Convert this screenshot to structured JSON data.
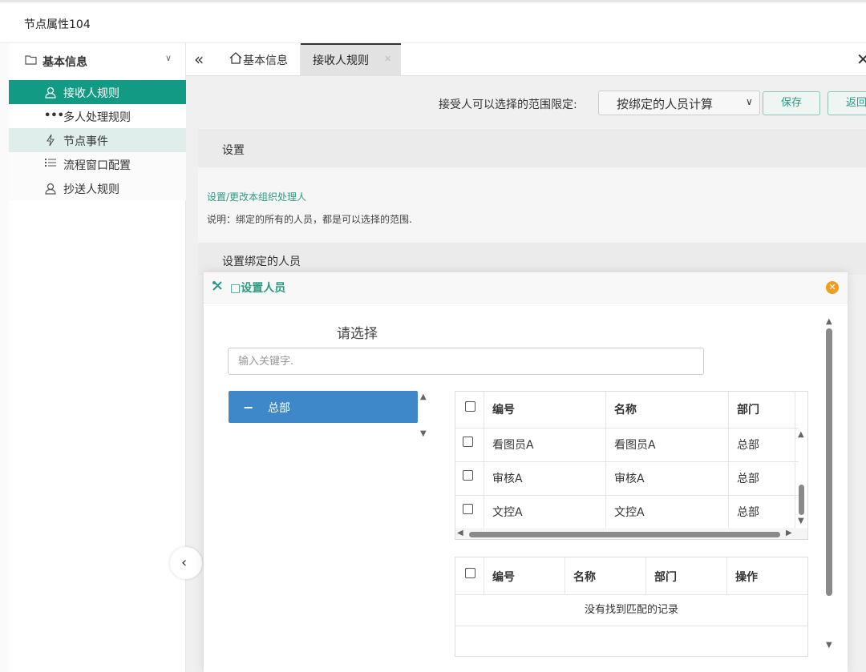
{
  "window": {
    "title": "节点属性104"
  },
  "sidebar": {
    "section": {
      "label": "基本信息",
      "icon": "folder-icon",
      "chevron": "∨"
    },
    "items": [
      {
        "label": "接收人规则",
        "icon": "user-icon",
        "state": "active"
      },
      {
        "label": "多人处理规则",
        "icon": "ellipsis-icon",
        "state": "normal"
      },
      {
        "label": "节点事件",
        "icon": "bolt-icon",
        "state": "hover"
      },
      {
        "label": "流程窗口配置",
        "icon": "list-icon",
        "state": "normal"
      },
      {
        "label": "抄送人规则",
        "icon": "user-icon",
        "state": "normal"
      }
    ]
  },
  "tabs": [
    {
      "label": "基本信息",
      "icon": "home-icon"
    },
    {
      "label": "接收人规则",
      "active": true
    }
  ],
  "toolbar": {
    "range_label": "接受人可以选择的范围限定:",
    "range_value": "按绑定的人员计算",
    "save_label": "保存",
    "back_label": "返回"
  },
  "settings": {
    "title": "设置",
    "link": "设置/更改本组织处理人",
    "note": "说明：绑定的所有的人员，都是可以选择的范围."
  },
  "bound": {
    "title": "设置绑定的人员"
  },
  "modal": {
    "title": "□设置人员",
    "pick_title": "请选择",
    "keyword_placeholder": "输入关键字.",
    "tree_node": "总部",
    "candidates": {
      "headers": [
        "编号",
        "名称",
        "部门"
      ],
      "rows": [
        [
          "看图员A",
          "看图员A",
          "总部"
        ],
        [
          "审核A",
          "审核A",
          "总部"
        ],
        [
          "文控A",
          "文控A",
          "总部"
        ]
      ]
    },
    "selected": {
      "headers": [
        "编号",
        "名称",
        "部门",
        "操作"
      ],
      "empty_text": "没有找到匹配的记录"
    }
  },
  "colors": {
    "accent": "#139a85",
    "accent_text": "#2c9b85",
    "tree_blue": "#3e88c9",
    "close_orange": "#f39c22"
  }
}
